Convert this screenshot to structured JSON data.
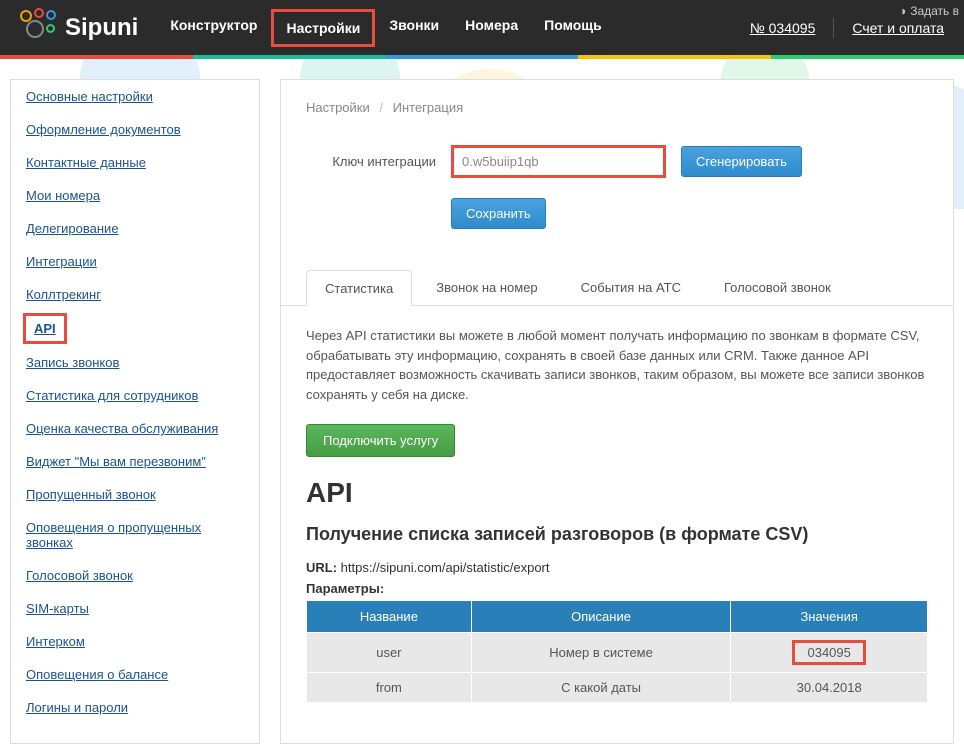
{
  "header": {
    "brand": "Sipuni",
    "nav": [
      {
        "label": "Конструктор",
        "hl": false
      },
      {
        "label": "Настройки",
        "hl": true
      },
      {
        "label": "Звонки",
        "hl": false
      },
      {
        "label": "Номера",
        "hl": false
      },
      {
        "label": "Помощь",
        "hl": false
      }
    ],
    "acct_prefix": "№ ",
    "acct_num": "034095",
    "billing": "Счет и оплата",
    "top_btn": "Задать в"
  },
  "colors": [
    "#e74c3c",
    "#1abc9c",
    "#3498db",
    "#f1c40f",
    "#2ecc71"
  ],
  "sidebar": [
    {
      "label": "Основные настройки",
      "hl": false
    },
    {
      "label": "Оформление документов",
      "hl": false
    },
    {
      "label": "Контактные данные",
      "hl": false
    },
    {
      "label": "Мои номера",
      "hl": false
    },
    {
      "label": "Делегирование",
      "hl": false
    },
    {
      "label": "Интеграции",
      "hl": false
    },
    {
      "label": "Коллтрекинг",
      "hl": false
    },
    {
      "label": "API",
      "hl": true
    },
    {
      "label": "Запись звонков",
      "hl": false
    },
    {
      "label": "Статистика для сотрудников",
      "hl": false
    },
    {
      "label": "Оценка качества обслуживания",
      "hl": false
    },
    {
      "label": "Виджет \"Мы вам перезвоним\"",
      "hl": false
    },
    {
      "label": "Пропущенный звонок",
      "hl": false
    },
    {
      "label": "Оповещения о пропущенных звонках",
      "hl": false
    },
    {
      "label": "Голосовой звонок",
      "hl": false
    },
    {
      "label": "SIM-карты",
      "hl": false
    },
    {
      "label": "Интерком",
      "hl": false
    },
    {
      "label": "Оповещения о балансе",
      "hl": false
    },
    {
      "label": "Логины и пароли",
      "hl": false
    }
  ],
  "breadcrumb": {
    "p1": "Настройки",
    "p2": "Интеграция"
  },
  "form": {
    "key_label": "Ключ интеграции",
    "key_value": "0.w5buiip1qb",
    "generate_btn": "Сгенерировать",
    "save_btn": "Сохранить"
  },
  "tabs": [
    {
      "label": "Статистика",
      "active": true
    },
    {
      "label": "Звонок на номер",
      "active": false
    },
    {
      "label": "События на АТС",
      "active": false
    },
    {
      "label": "Голосовой звонок",
      "active": false
    }
  ],
  "desc": "Через API статистики вы можете в любой момент получать информацию по звонкам в формате CSV, обрабатывать эту информацию, сохранять в своей базе данных или CRM. Также данное API предоставляет возможность скачивать записи звонков, таким образом, вы можете все записи звонков сохранять у себя на диске.",
  "connect_btn": "Подключить услугу",
  "api_h1": "API",
  "api_h2": "Получение списка записей разговоров (в формате CSV)",
  "url_label": "URL:",
  "url_value": "https://sipuni.com/api/statistic/export",
  "params_label": "Параметры:",
  "table": {
    "headers": [
      "Название",
      "Описание",
      "Значения"
    ],
    "rows": [
      {
        "c1": "user",
        "c2": "Номер в системе",
        "c3": "034095",
        "hl": true
      },
      {
        "c1": "from",
        "c2": "С какой даты",
        "c3": "30.04.2018",
        "hl": false
      }
    ]
  }
}
